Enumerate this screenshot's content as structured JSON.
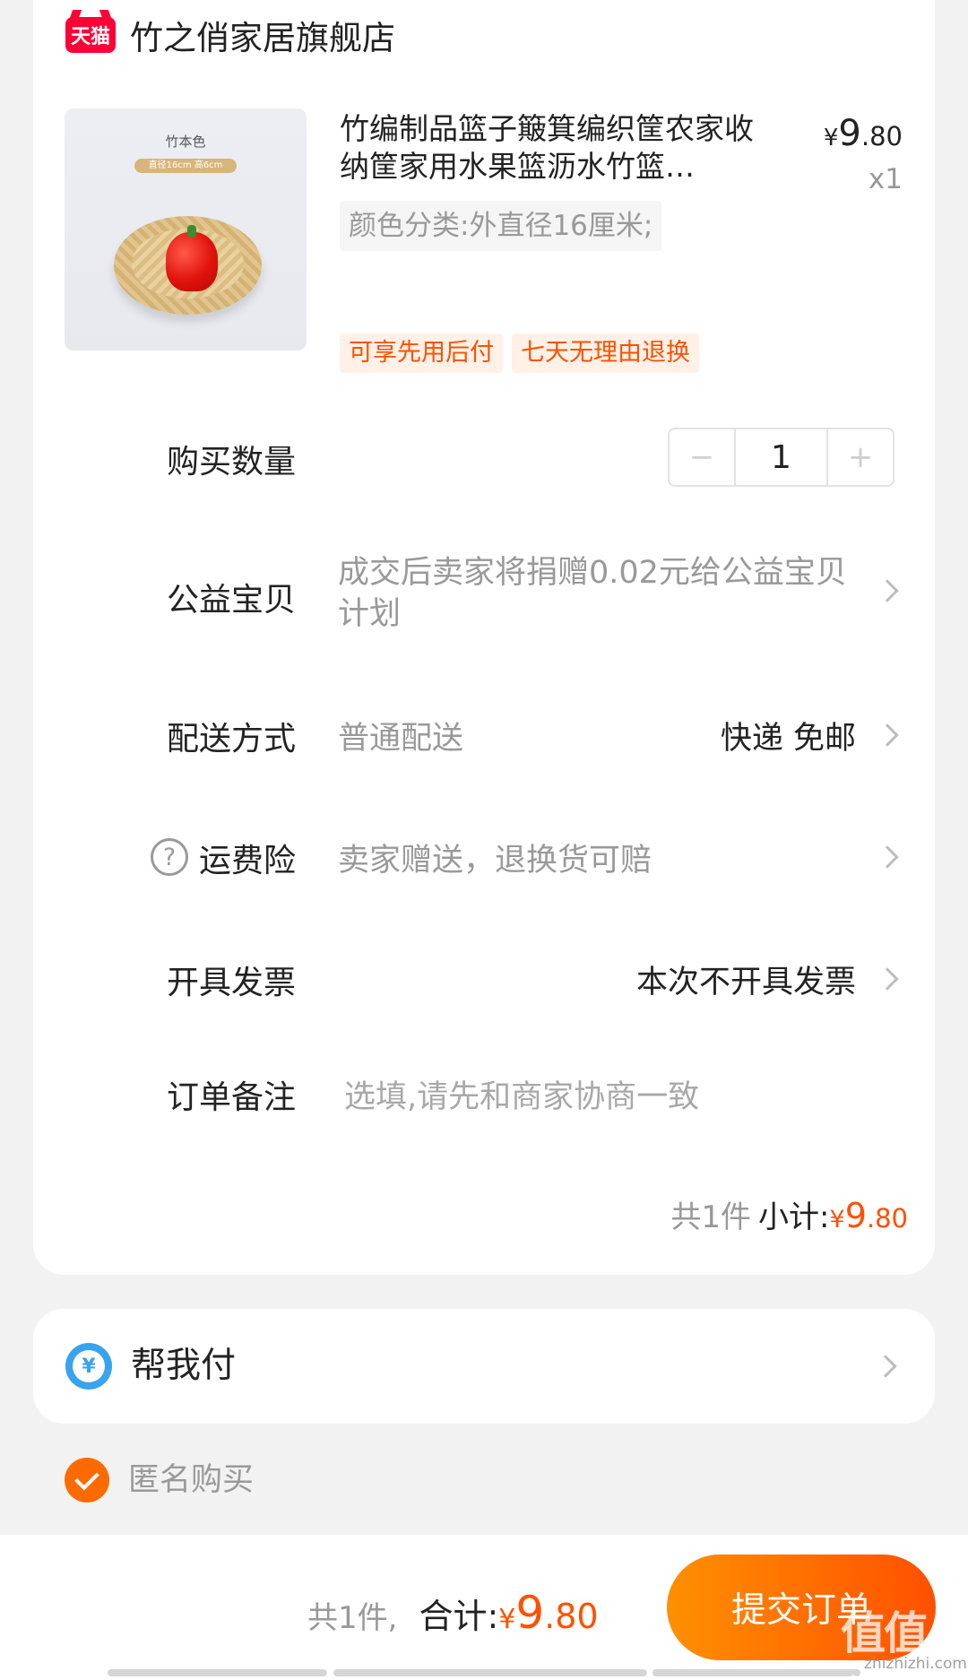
{
  "store": {
    "logo_text": "天猫",
    "name": "竹之俏家居旗舰店"
  },
  "product": {
    "image_label": "竹本色",
    "image_size": "直径16cm 高6cm",
    "title": "竹编制品篮子簸箕编织筐农家收纳筐家用水果篮沥水竹篮…",
    "price_symbol": "¥",
    "price_int": "9",
    "price_dec": ".80",
    "quantity_text": "x1",
    "sku": "颜色分类:外直径16厘米;",
    "tags": [
      "可享先用后付",
      "七天无理由退换"
    ]
  },
  "quantity_row": {
    "label": "购买数量",
    "minus": "−",
    "value": "1",
    "plus": "+"
  },
  "charity_row": {
    "label": "公益宝贝",
    "value": "成交后卖家将捐赠0.02元给公益宝贝计划"
  },
  "delivery_row": {
    "label": "配送方式",
    "value": "普通配送",
    "right": "快递 免邮"
  },
  "insurance_row": {
    "label": "运费险",
    "icon_text": "?",
    "value": "卖家赠送，退换货可赔"
  },
  "invoice_row": {
    "label": "开具发票",
    "right": "本次不开具发票"
  },
  "note_row": {
    "label": "订单备注",
    "placeholder": "选填,请先和商家协商一致"
  },
  "subtotal": {
    "count": "共1件",
    "label": "小计:",
    "symbol": "¥",
    "int": "9",
    "dec": ".80"
  },
  "help_pay": {
    "icon_text": "¥",
    "label": "帮我付"
  },
  "anonymous": {
    "label": "匿名购买",
    "checked": true
  },
  "bottom": {
    "count": "共1件,",
    "label": "合计:",
    "symbol": "¥",
    "int": "9",
    "dec": ".80",
    "submit": "提交订单"
  },
  "watermark": {
    "text": "值值值",
    "sub": "zhizhizhi.com"
  },
  "colors": {
    "accent": "#ff5000",
    "tmall_red": "#ff0036",
    "pay_blue": "#38a3ef",
    "background": "#f2f2f2"
  }
}
